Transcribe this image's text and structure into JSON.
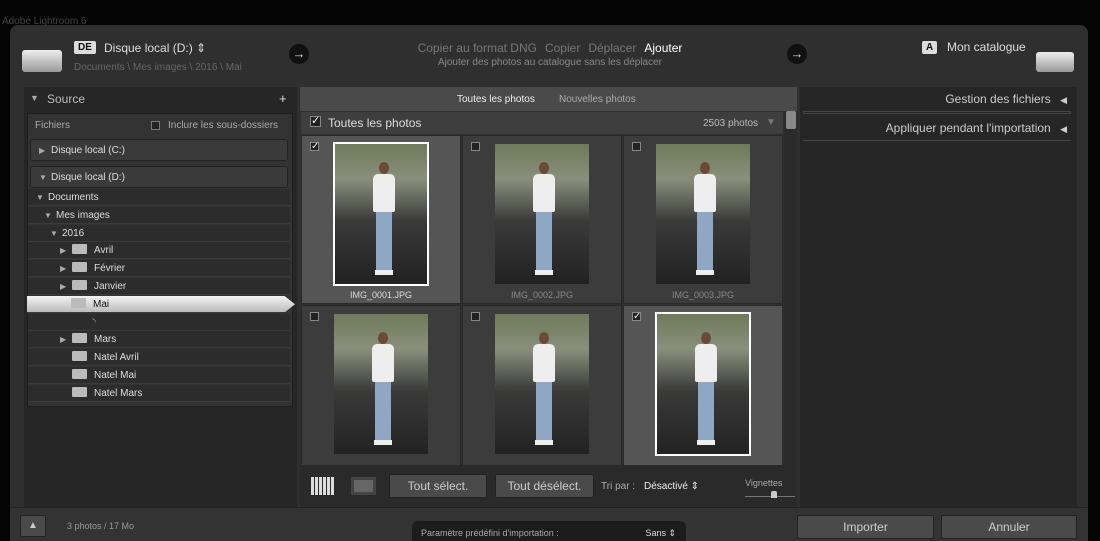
{
  "app_title": "Adobe Lightroom 6",
  "header": {
    "source_badge": "DE",
    "source_drive": "Disque local (D:)",
    "source_path": "Documents \\ Mes images \\ 2016 \\ Mai",
    "modes": [
      "Copier au format DNG",
      "Copier",
      "Déplacer",
      "Ajouter"
    ],
    "active_mode": "Ajouter",
    "mode_description": "Ajouter des photos au catalogue sans les déplacer",
    "dest_badge": "A",
    "dest_label": "Mon catalogue"
  },
  "source_panel": {
    "title": "Source",
    "files_label": "Fichiers",
    "include_subfolders": "Inclure les sous-dossiers",
    "drives": [
      "Disque local (C:)",
      "Disque local (D:)"
    ],
    "tree": [
      {
        "label": "Documents",
        "level": 0,
        "expanded": true
      },
      {
        "label": "Mes images",
        "level": 1,
        "expanded": true
      },
      {
        "label": "2016",
        "level": 2,
        "expanded": true
      },
      {
        "label": "Avril",
        "level": 3,
        "folder": true,
        "arrow": true
      },
      {
        "label": "Février",
        "level": 3,
        "folder": true,
        "arrow": true
      },
      {
        "label": "Janvier",
        "level": 3,
        "folder": true,
        "arrow": true
      },
      {
        "label": "Mai",
        "level": 3,
        "folder": true,
        "selected": true
      },
      {
        "label": "",
        "level": 3,
        "loading": true
      },
      {
        "label": "Mars",
        "level": 3,
        "folder": true,
        "arrow": true
      },
      {
        "label": "Natel Avril",
        "level": 3,
        "folder": true
      },
      {
        "label": "Natel Mai",
        "level": 3,
        "folder": true
      },
      {
        "label": "Natel Mars",
        "level": 3,
        "folder": true
      }
    ]
  },
  "grid": {
    "tabs": [
      "Toutes les photos",
      "Nouvelles photos"
    ],
    "header_label": "Toutes les photos",
    "count": "2503 photos",
    "photos": [
      {
        "name": "IMG_0001.JPG",
        "checked": true
      },
      {
        "name": "IMG_0002.JPG",
        "checked": false
      },
      {
        "name": "IMG_0003.JPG",
        "checked": false
      },
      {
        "name": "",
        "checked": false
      },
      {
        "name": "",
        "checked": false
      },
      {
        "name": "",
        "checked": true
      }
    ],
    "select_all": "Tout sélect.",
    "deselect_all": "Tout désélect.",
    "sort_label": "Tri par :",
    "sort_value": "Désactivé",
    "thumbnails_label": "Vignettes"
  },
  "right_panel": {
    "sections": [
      "Gestion des fichiers",
      "Appliquer pendant l'importation"
    ]
  },
  "footer": {
    "summary": "3 photos / 17 Mo",
    "preset_label": "Paramètre prédéfini d'importation :",
    "preset_value": "Sans",
    "import": "Importer",
    "cancel": "Annuler"
  }
}
